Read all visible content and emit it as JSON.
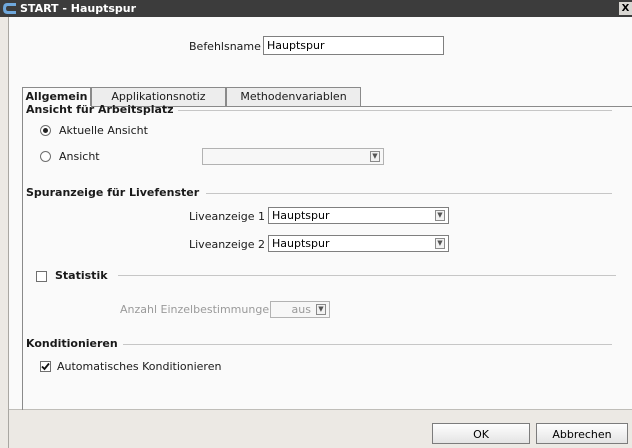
{
  "window": {
    "title": "START - Hauptspur",
    "close_label": "X"
  },
  "header": {
    "command_label": "Befehlsname",
    "command_value": "Hauptspur"
  },
  "tabs": [
    {
      "label": "Allgemein"
    },
    {
      "label": "Applikationsnotiz"
    },
    {
      "label": "Methodenvariablen"
    }
  ],
  "workplace_view": {
    "heading": "Ansicht für Arbeitsplatz",
    "option_current": "Aktuelle Ansicht",
    "option_view": "Ansicht",
    "view_value": ""
  },
  "trace_display": {
    "heading": "Spuranzeige für Livefenster",
    "live1_label": "Liveanzeige 1",
    "live1_value": "Hauptspur",
    "live2_label": "Liveanzeige 2",
    "live2_value": "Hauptspur"
  },
  "statistics": {
    "heading": "Statistik",
    "checked": false,
    "count_label": "Anzahl Einzelbestimmungen",
    "count_value": "aus"
  },
  "conditioning": {
    "heading": "Konditionieren",
    "auto_label": "Automatisches Konditionieren",
    "checked": true
  },
  "buttons": {
    "ok": "OK",
    "cancel": "Abbrechen"
  },
  "icons": {
    "app_logo": "s-logo-icon",
    "dropdown": "chevron-down-icon",
    "close": "close-icon"
  },
  "colors": {
    "titlebar": "#3c3c3c",
    "logo": "#6fa8dc",
    "background": "#fafafa"
  }
}
